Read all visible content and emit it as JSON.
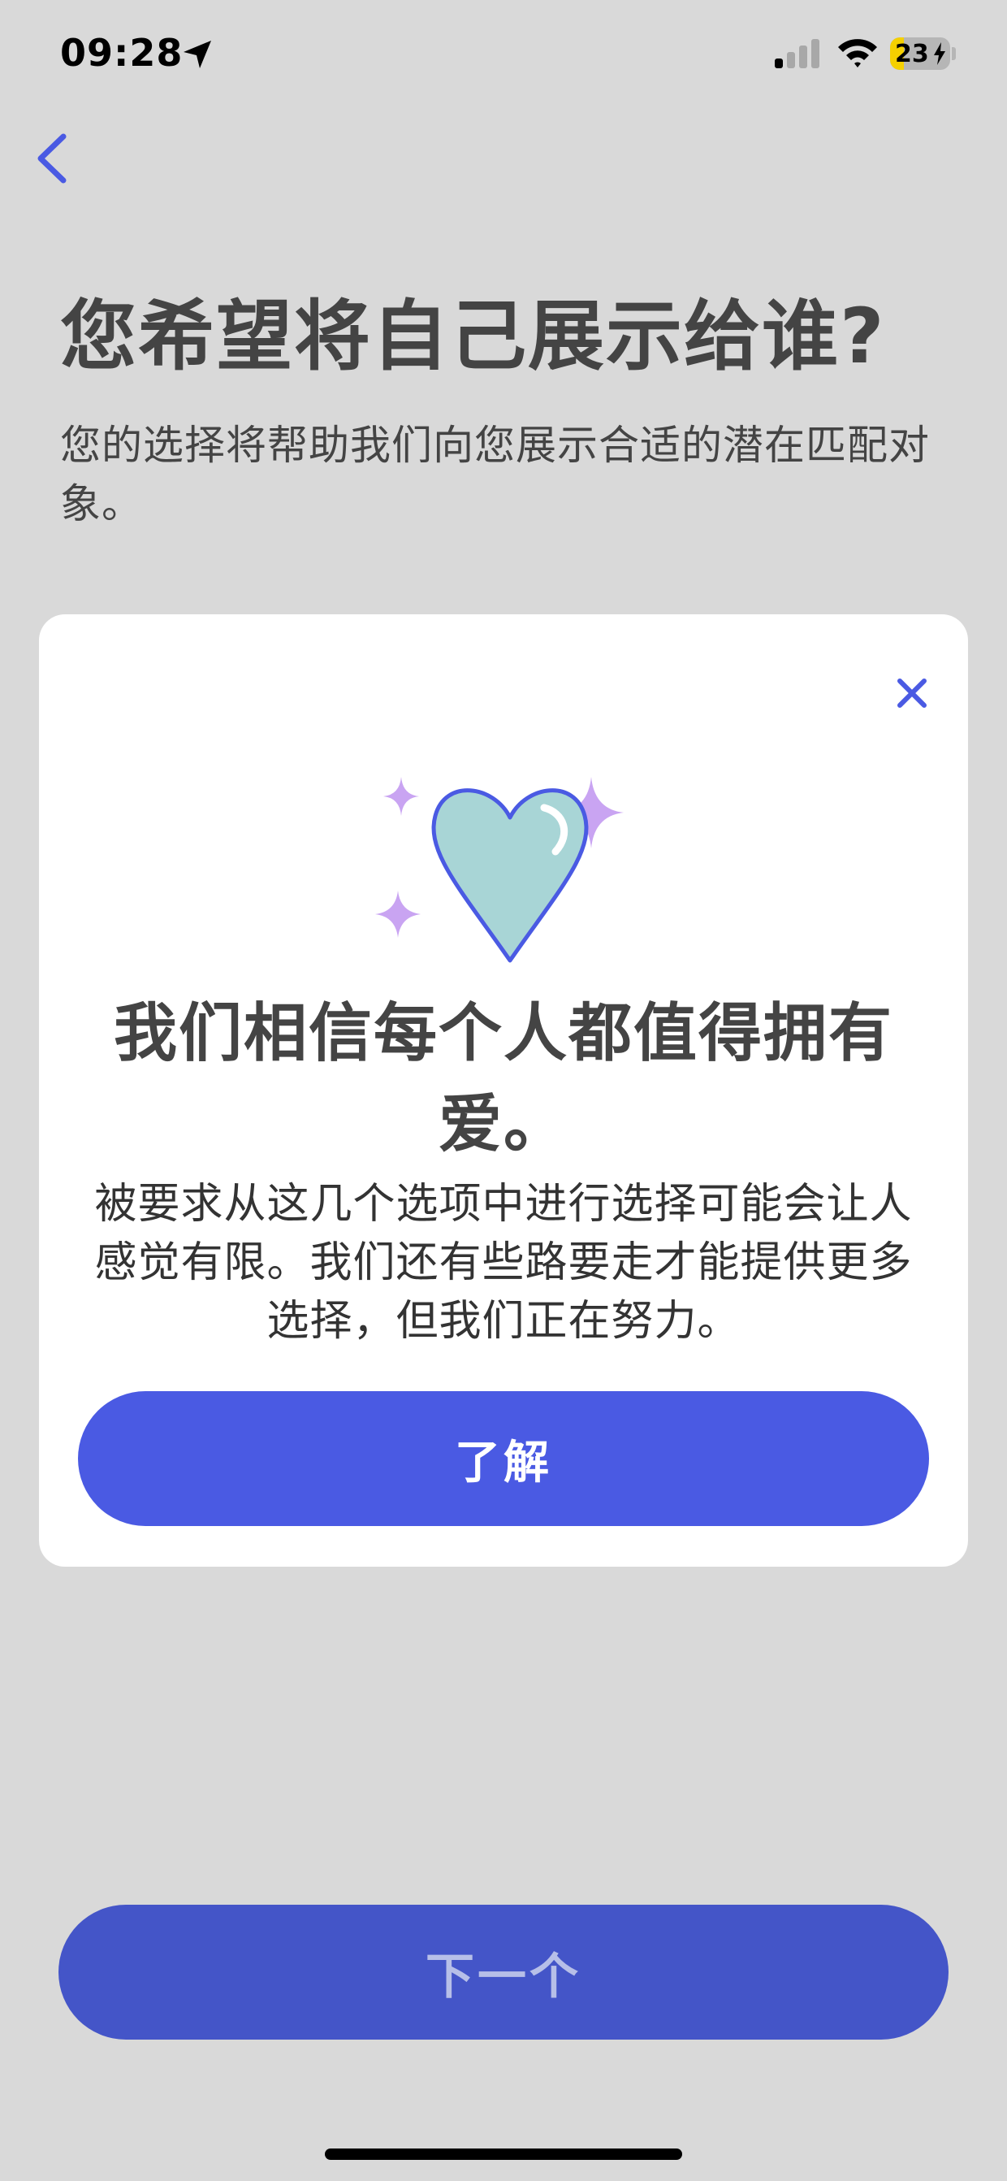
{
  "status_bar": {
    "time": "09:28",
    "battery_level": "23",
    "battery_fraction": 0.23,
    "icons": [
      "location-arrow-icon",
      "cellular-signal-icon",
      "wifi-icon",
      "battery-icon",
      "charging-bolt-icon"
    ]
  },
  "header": {
    "back_icon": "chevron-left-icon",
    "title": "您希望将自己展示给谁?",
    "subtitle": "您的选择将帮助我们向您展示合适的潜在匹配对象。"
  },
  "modal": {
    "close_icon": "close-icon",
    "illustration": "sparkling-heart-icon",
    "heading": "我们相信每个人都值得拥有爱。",
    "body": "被要求从这几个选项中进行选择可能会让人感觉有限。我们还有些路要走才能提供更多选择，但我们正在努力。",
    "button_label": "了解"
  },
  "footer": {
    "next_label": "下一个"
  },
  "colors": {
    "background": "#d9d9d9",
    "accent": "#4a5ae3",
    "heart_fill": "#a8d5d6",
    "sparkle": "#c9a4f2",
    "text": "#444444"
  }
}
